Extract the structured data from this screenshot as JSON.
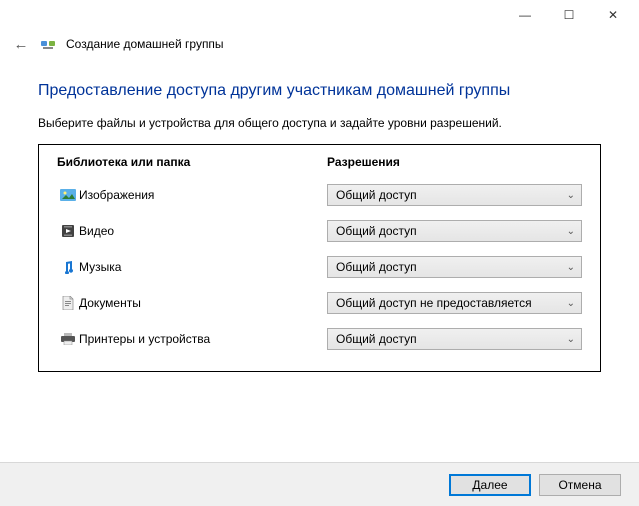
{
  "titlebar": {
    "minimize_glyph": "—",
    "maximize_glyph": "☐",
    "close_glyph": "✕"
  },
  "header": {
    "back_glyph": "←",
    "title": "Создание домашней группы"
  },
  "main": {
    "heading": "Предоставление доступа другим участникам домашней группы",
    "subheading": "Выберите файлы и устройства для общего доступа и задайте уровни разрешений.",
    "col_library": "Библиотека или папка",
    "col_permission": "Разрешения",
    "rows": [
      {
        "icon": "pictures-icon",
        "label": "Изображения",
        "permission": "Общий доступ"
      },
      {
        "icon": "videos-icon",
        "label": "Видео",
        "permission": "Общий доступ"
      },
      {
        "icon": "music-icon",
        "label": "Музыка",
        "permission": "Общий доступ"
      },
      {
        "icon": "documents-icon",
        "label": "Документы",
        "permission": "Общий доступ не предоставляется"
      },
      {
        "icon": "printers-icon",
        "label": "Принтеры и устройства",
        "permission": "Общий доступ"
      }
    ]
  },
  "footer": {
    "next_label": "Далее",
    "cancel_label": "Отмена"
  }
}
